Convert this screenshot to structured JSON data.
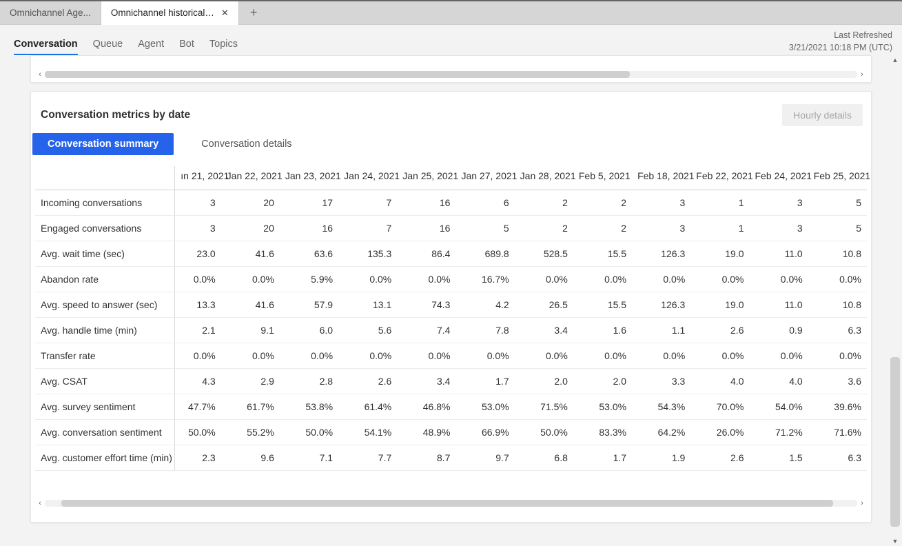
{
  "tabs": {
    "items": [
      {
        "label": "Omnichannel Age...",
        "active": false,
        "closeable": false
      },
      {
        "label": "Omnichannel historical an...",
        "active": true,
        "closeable": true
      }
    ],
    "add_icon": "+"
  },
  "subtabs": {
    "items": [
      {
        "label": "Conversation",
        "active": true
      },
      {
        "label": "Queue",
        "active": false
      },
      {
        "label": "Agent",
        "active": false
      },
      {
        "label": "Bot",
        "active": false
      },
      {
        "label": "Topics",
        "active": false
      }
    ]
  },
  "refresh": {
    "label": "Last Refreshed",
    "value": "3/21/2021 10:18 PM (UTC)"
  },
  "card": {
    "title": "Conversation metrics by date",
    "hourly_button": "Hourly details",
    "segments": [
      {
        "label": "Conversation summary",
        "active": true
      },
      {
        "label": "Conversation details",
        "active": false
      }
    ],
    "columns": [
      "ın 21, 2021",
      "Jan 22, 2021",
      "Jan 23, 2021",
      "Jan 24, 2021",
      "Jan 25, 2021",
      "Jan 27, 2021",
      "Jan 28, 2021",
      "Feb 5, 2021",
      "Feb 18, 2021",
      "Feb 22, 2021",
      "Feb 24, 2021",
      "Feb 25, 2021"
    ],
    "metrics": [
      {
        "name": "Incoming conversations",
        "values": [
          "3",
          "20",
          "17",
          "7",
          "16",
          "6",
          "2",
          "2",
          "3",
          "1",
          "3",
          "5"
        ]
      },
      {
        "name": "Engaged conversations",
        "values": [
          "3",
          "20",
          "16",
          "7",
          "16",
          "5",
          "2",
          "2",
          "3",
          "1",
          "3",
          "5"
        ]
      },
      {
        "name": "Avg. wait time (sec)",
        "values": [
          "23.0",
          "41.6",
          "63.6",
          "135.3",
          "86.4",
          "689.8",
          "528.5",
          "15.5",
          "126.3",
          "19.0",
          "11.0",
          "10.8"
        ]
      },
      {
        "name": "Abandon rate",
        "values": [
          "0.0%",
          "0.0%",
          "5.9%",
          "0.0%",
          "0.0%",
          "16.7%",
          "0.0%",
          "0.0%",
          "0.0%",
          "0.0%",
          "0.0%",
          "0.0%"
        ]
      },
      {
        "name": "Avg. speed to answer (sec)",
        "values": [
          "13.3",
          "41.6",
          "57.9",
          "13.1",
          "74.3",
          "4.2",
          "26.5",
          "15.5",
          "126.3",
          "19.0",
          "11.0",
          "10.8"
        ]
      },
      {
        "name": "Avg. handle time (min)",
        "values": [
          "2.1",
          "9.1",
          "6.0",
          "5.6",
          "7.4",
          "7.8",
          "3.4",
          "1.6",
          "1.1",
          "2.6",
          "0.9",
          "6.3"
        ]
      },
      {
        "name": "Transfer rate",
        "values": [
          "0.0%",
          "0.0%",
          "0.0%",
          "0.0%",
          "0.0%",
          "0.0%",
          "0.0%",
          "0.0%",
          "0.0%",
          "0.0%",
          "0.0%",
          "0.0%"
        ]
      },
      {
        "name": "Avg. CSAT",
        "values": [
          "4.3",
          "2.9",
          "2.8",
          "2.6",
          "3.4",
          "1.7",
          "2.0",
          "2.0",
          "3.3",
          "4.0",
          "4.0",
          "3.6"
        ]
      },
      {
        "name": "Avg. survey sentiment",
        "values": [
          "47.7%",
          "61.7%",
          "53.8%",
          "61.4%",
          "46.8%",
          "53.0%",
          "71.5%",
          "53.0%",
          "54.3%",
          "70.0%",
          "54.0%",
          "39.6%"
        ]
      },
      {
        "name": "Avg. conversation sentiment",
        "values": [
          "50.0%",
          "55.2%",
          "50.0%",
          "54.1%",
          "48.9%",
          "66.9%",
          "50.0%",
          "83.3%",
          "64.2%",
          "26.0%",
          "71.2%",
          "71.6%"
        ]
      },
      {
        "name": "Avg. customer effort time (min)",
        "values": [
          "2.3",
          "9.6",
          "7.1",
          "7.7",
          "8.7",
          "9.7",
          "6.8",
          "1.7",
          "1.9",
          "2.6",
          "1.5",
          "6.3"
        ]
      }
    ]
  },
  "scroll": {
    "left_arrow": "‹",
    "right_arrow": "›",
    "up_arrow": "▲",
    "down_arrow": "▼"
  }
}
